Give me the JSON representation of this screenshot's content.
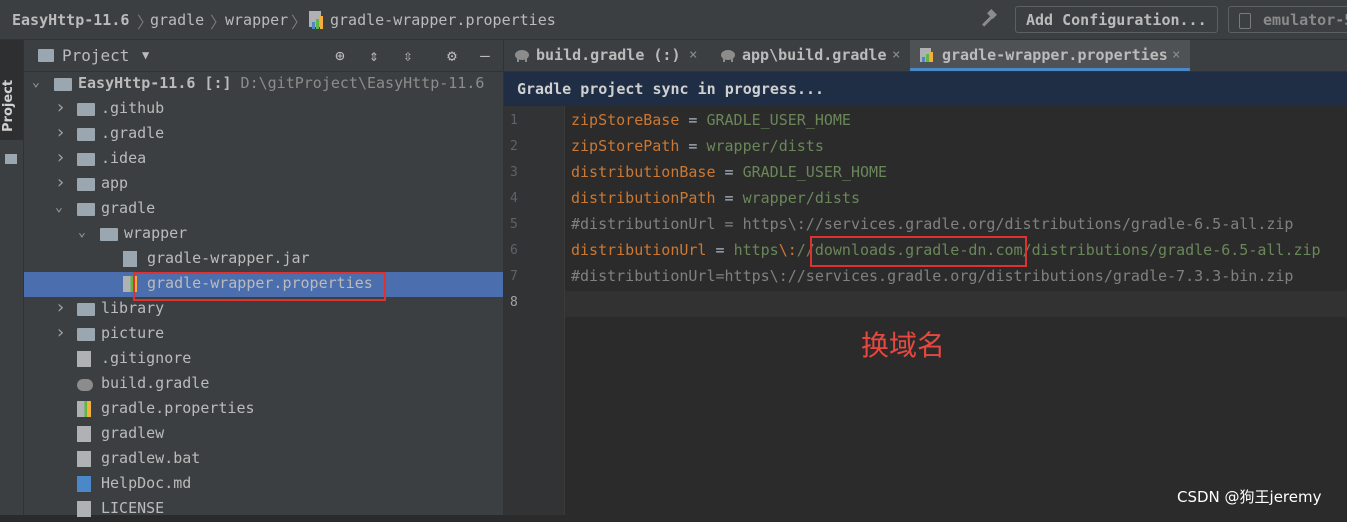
{
  "navbar": {
    "breadcrumbs": [
      "EasyHttp-11.6",
      "gradle",
      "wrapper",
      "gradle-wrapper.properties"
    ],
    "add_config": "Add Configuration...",
    "device": "emulator-5"
  },
  "stripe": {
    "label": "Project"
  },
  "project_panel": {
    "title": "Project",
    "tree": [
      {
        "label": "EasyHttp-11.6 [:]",
        "path": "D:\\gitProject\\EasyHttp-11.6",
        "depth": 0,
        "arrow": "open",
        "icon": "module-icon"
      },
      {
        "label": ".github",
        "depth": 1,
        "arrow": "closed",
        "icon": "folder-icon"
      },
      {
        "label": ".gradle",
        "depth": 1,
        "arrow": "closed",
        "icon": "folder-icon"
      },
      {
        "label": ".idea",
        "depth": 1,
        "arrow": "closed",
        "icon": "folder-icon"
      },
      {
        "label": "app",
        "depth": 1,
        "arrow": "closed",
        "icon": "folder-icon"
      },
      {
        "label": "gradle",
        "depth": 1,
        "arrow": "open",
        "icon": "folder-icon"
      },
      {
        "label": "wrapper",
        "depth": 2,
        "arrow": "open",
        "icon": "folder-icon"
      },
      {
        "label": "gradle-wrapper.jar",
        "depth": 3,
        "arrow": "none",
        "icon": "jar-icon"
      },
      {
        "label": "gradle-wrapper.properties",
        "depth": 3,
        "arrow": "none",
        "icon": "properties-icon",
        "selected": true
      },
      {
        "label": "library",
        "depth": 1,
        "arrow": "closed",
        "icon": "folder-icon"
      },
      {
        "label": "picture",
        "depth": 1,
        "arrow": "closed",
        "icon": "folder-icon"
      },
      {
        "label": ".gitignore",
        "depth": 1,
        "arrow": "none",
        "icon": "gitignore-icon"
      },
      {
        "label": "build.gradle",
        "depth": 1,
        "arrow": "none",
        "icon": "gradle-icon"
      },
      {
        "label": "gradle.properties",
        "depth": 1,
        "arrow": "none",
        "icon": "properties-icon"
      },
      {
        "label": "gradlew",
        "depth": 1,
        "arrow": "none",
        "icon": "shell-icon"
      },
      {
        "label": "gradlew.bat",
        "depth": 1,
        "arrow": "none",
        "icon": "file-icon"
      },
      {
        "label": "HelpDoc.md",
        "depth": 1,
        "arrow": "none",
        "icon": "markdown-icon"
      },
      {
        "label": "LICENSE",
        "depth": 1,
        "arrow": "none",
        "icon": "file-icon"
      }
    ]
  },
  "editor": {
    "tabs": [
      {
        "label": "build.gradle (:)",
        "active": false
      },
      {
        "label": "app\\build.gradle",
        "active": false
      },
      {
        "label": "gradle-wrapper.properties",
        "active": true
      }
    ],
    "banner": "Gradle project sync in progress...",
    "lines": [
      {
        "n": "1",
        "key": "zipStoreBase",
        "eq": " = ",
        "val": "GRADLE_USER_HOME"
      },
      {
        "n": "2",
        "key": "zipStorePath",
        "eq": " = ",
        "val": "wrapper/dists"
      },
      {
        "n": "3",
        "key": "distributionBase",
        "eq": " = ",
        "val": "GRADLE_USER_HOME"
      },
      {
        "n": "4",
        "key": "distributionPath",
        "eq": " = ",
        "val": "wrapper/dists"
      },
      {
        "n": "5",
        "comment": "#distributionUrl = https\\://services.gradle.org/distributions/gradle-6.5-all.zip"
      },
      {
        "n": "6",
        "key": "distributionUrl",
        "eq": " = ",
        "val_a": "https",
        "esc": "\\:",
        "val_b": "//downloads.gradle-dn.com/distributions/gradle-6.5-all.zip"
      },
      {
        "n": "7",
        "comment": "#distributionUrl=https\\://services.gradle.org/distributions/gradle-7.3.3-bin.zip"
      },
      {
        "n": "8"
      }
    ]
  },
  "annotation": "换域名",
  "watermark": "CSDN @狗王jeremy",
  "colors": {
    "highlight_box": "#e03131",
    "annotation": "#e8473f",
    "selection": "#4b6eaf"
  }
}
